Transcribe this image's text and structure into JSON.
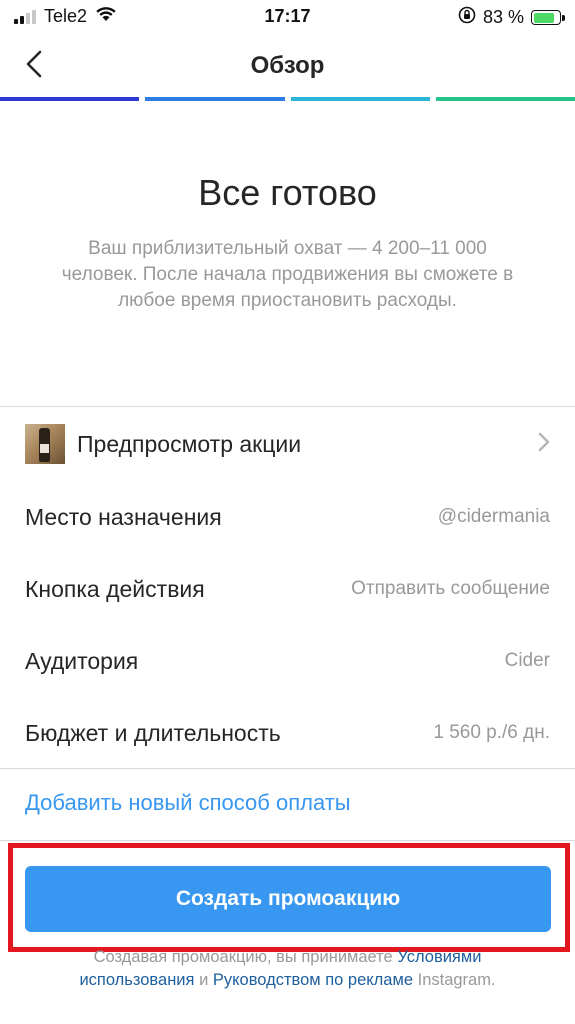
{
  "status_bar": {
    "carrier": "Tele2",
    "time": "17:17",
    "battery_percent": "83 %",
    "battery_level": 0.83
  },
  "nav": {
    "title": "Обзор"
  },
  "progress": {
    "segments": 4,
    "colors": [
      "#2b3bd4",
      "#2f7ee6",
      "#2bb3d8",
      "#27c489"
    ]
  },
  "hero": {
    "title": "Все готово",
    "description": "Ваш приблизительный охват — 4 200–11 000 человек. После начала продвижения вы сможете в любое время приостановить расходы."
  },
  "rows": [
    {
      "label": "Предпросмотр акции",
      "value": "",
      "icon": "promo-thumbnail"
    },
    {
      "label": "Место назначения",
      "value": "@cidermania"
    },
    {
      "label": "Кнопка действия",
      "value": "Отправить сообщение"
    },
    {
      "label": "Аудитория",
      "value": "Cider"
    },
    {
      "label": "Бюджет и длительность",
      "value": "1 560 р./6 дн."
    }
  ],
  "add_payment_label": "Добавить новый способ оплаты",
  "cta_label": "Создать промоакцию",
  "legal": {
    "prefix": "Создавая промоакцию, вы принимаете",
    "terms_link": "Условиями использования",
    "conjunction": "и",
    "guidelines_link": "Руководством по рекламе",
    "suffix": "Instagram."
  },
  "colors": {
    "accent": "#3897f0",
    "highlight": "#e3171d",
    "link_dark": "#1e5f9e"
  }
}
